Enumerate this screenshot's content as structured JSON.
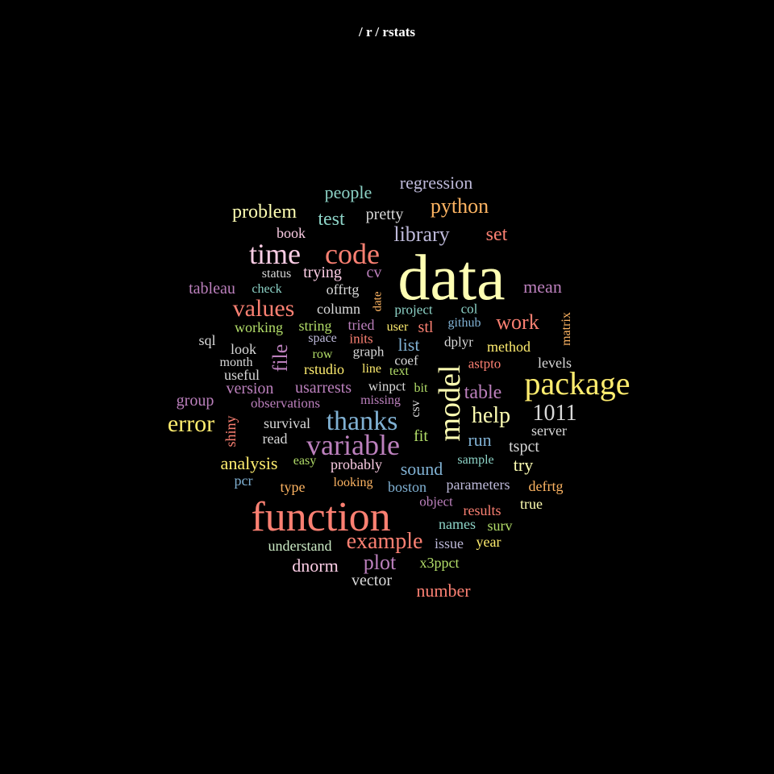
{
  "title": "/ r / rstats",
  "palette": {
    "yellow": "#FFFFB3",
    "red": "#FB8072",
    "blue": "#80B1D3",
    "orange": "#FDB462",
    "green": "#B3DE69",
    "pink": "#FCCDE5",
    "gray": "#D9D9D9",
    "purple": "#BC80BD",
    "mint": "#CCEBC5",
    "gold": "#FFED6F",
    "teal": "#8DD3C7",
    "lavender": "#BEBADA"
  },
  "words": [
    {
      "text": "data",
      "color": "#FFFFB3",
      "vertical": false
    },
    {
      "text": "function",
      "color": "#FB8072",
      "vertical": false
    },
    {
      "text": "package",
      "color": "#FFED6F",
      "vertical": false
    },
    {
      "text": "model",
      "color": "#FFFFB3",
      "vertical": true
    },
    {
      "text": "code",
      "color": "#FB8072",
      "vertical": false
    },
    {
      "text": "time",
      "color": "#FCCDE5",
      "vertical": false
    },
    {
      "text": "variable",
      "color": "#BC80BD",
      "vertical": false
    },
    {
      "text": "thanks",
      "color": "#80B1D3",
      "vertical": false
    },
    {
      "text": "values",
      "color": "#FB8072",
      "vertical": false
    },
    {
      "text": "error",
      "color": "#FFED6F",
      "vertical": false
    },
    {
      "text": "example",
      "color": "#FB8072",
      "vertical": false
    },
    {
      "text": "1011",
      "color": "#D9D9D9",
      "vertical": false
    },
    {
      "text": "help",
      "color": "#FFFFB3",
      "vertical": false
    },
    {
      "text": "python",
      "color": "#FDB462",
      "vertical": false
    },
    {
      "text": "library",
      "color": "#BEBADA",
      "vertical": false
    },
    {
      "text": "file",
      "color": "#BC80BD",
      "vertical": true
    },
    {
      "text": "plot",
      "color": "#BC80BD",
      "vertical": false
    },
    {
      "text": "problem",
      "color": "#FFFFB3",
      "vertical": false
    },
    {
      "text": "work",
      "color": "#FB8072",
      "vertical": false
    },
    {
      "text": "table",
      "color": "#BC80BD",
      "vertical": false
    },
    {
      "text": "regression",
      "color": "#BEBADA",
      "vertical": false
    },
    {
      "text": "test",
      "color": "#8DD3C7",
      "vertical": false
    },
    {
      "text": "list",
      "color": "#80B1D3",
      "vertical": false
    },
    {
      "text": "set",
      "color": "#FB8072",
      "vertical": false
    },
    {
      "text": "sound",
      "color": "#80B1D3",
      "vertical": false
    },
    {
      "text": "analysis",
      "color": "#FFED6F",
      "vertical": false
    },
    {
      "text": "mean",
      "color": "#BC80BD",
      "vertical": false
    },
    {
      "text": "people",
      "color": "#8DD3C7",
      "vertical": false
    },
    {
      "text": "pretty",
      "color": "#D9D9D9",
      "vertical": false
    },
    {
      "text": "number",
      "color": "#FB8072",
      "vertical": false
    },
    {
      "text": "run",
      "color": "#80B1D3",
      "vertical": false
    },
    {
      "text": "dnorm",
      "color": "#FCCDE5",
      "vertical": false
    },
    {
      "text": "usarrests",
      "color": "#BC80BD",
      "vertical": false
    },
    {
      "text": "try",
      "color": "#FFFFB3",
      "vertical": false
    },
    {
      "text": "vector",
      "color": "#D9D9D9",
      "vertical": false
    },
    {
      "text": "tableau",
      "color": "#BC80BD",
      "vertical": false
    },
    {
      "text": "cv",
      "color": "#BC80BD",
      "vertical": false
    },
    {
      "text": "trying",
      "color": "#FCCDE5",
      "vertical": false
    },
    {
      "text": "version",
      "color": "#BC80BD",
      "vertical": false
    },
    {
      "text": "probably",
      "color": "#FCCDE5",
      "vertical": false
    },
    {
      "text": "tspct",
      "color": "#D9D9D9",
      "vertical": false
    },
    {
      "text": "server",
      "color": "#D9D9D9",
      "vertical": false
    },
    {
      "text": "levels",
      "color": "#D9D9D9",
      "vertical": false
    },
    {
      "text": "book",
      "color": "#FCCDE5",
      "vertical": false
    },
    {
      "text": "read",
      "color": "#D9D9D9",
      "vertical": false
    },
    {
      "text": "year",
      "color": "#FFED6F",
      "vertical": false
    },
    {
      "text": "group",
      "color": "#BC80BD",
      "vertical": false
    },
    {
      "text": "method",
      "color": "#FFED6F",
      "vertical": false
    },
    {
      "text": "stl",
      "color": "#FB8072",
      "vertical": false
    },
    {
      "text": "fit",
      "color": "#B3DE69",
      "vertical": false
    },
    {
      "text": "look",
      "color": "#D9D9D9",
      "vertical": false
    },
    {
      "text": "working",
      "color": "#B3DE69",
      "vertical": false
    },
    {
      "text": "string",
      "color": "#B3DE69",
      "vertical": false
    },
    {
      "text": "tried",
      "color": "#BC80BD",
      "vertical": false
    },
    {
      "text": "boston",
      "color": "#80B1D3",
      "vertical": false
    },
    {
      "text": "parameters",
      "color": "#BEBADA",
      "vertical": false
    },
    {
      "text": "defrtg",
      "color": "#FDB462",
      "vertical": false
    },
    {
      "text": "results",
      "color": "#FB8072",
      "vertical": false
    },
    {
      "text": "true",
      "color": "#FFFFB3",
      "vertical": false
    },
    {
      "text": "names",
      "color": "#8DD3C7",
      "vertical": false
    },
    {
      "text": "surv",
      "color": "#B3DE69",
      "vertical": false
    },
    {
      "text": "understand",
      "color": "#CCEBC5",
      "vertical": false
    },
    {
      "text": "issue",
      "color": "#BEBADA",
      "vertical": false
    },
    {
      "text": "x3ppct",
      "color": "#B3DE69",
      "vertical": false
    },
    {
      "text": "type",
      "color": "#FDB462",
      "vertical": false
    },
    {
      "text": "looking",
      "color": "#FDB462",
      "vertical": false
    },
    {
      "text": "object",
      "color": "#BC80BD",
      "vertical": false
    },
    {
      "text": "pcr",
      "color": "#80B1D3",
      "vertical": false
    },
    {
      "text": "easy",
      "color": "#B3DE69",
      "vertical": false
    },
    {
      "text": "sample",
      "color": "#8DD3C7",
      "vertical": false
    },
    {
      "text": "survival",
      "color": "#D9D9D9",
      "vertical": false
    },
    {
      "text": "shiny",
      "color": "#FB8072",
      "vertical": true
    },
    {
      "text": "observations",
      "color": "#BC80BD",
      "vertical": false
    },
    {
      "text": "missing",
      "color": "#BC80BD",
      "vertical": false
    },
    {
      "text": "winpct",
      "color": "#D9D9D9",
      "vertical": false
    },
    {
      "text": "csv",
      "color": "#D9D9D9",
      "vertical": true
    },
    {
      "text": "bit",
      "color": "#B3DE69",
      "vertical": false
    },
    {
      "text": "useful",
      "color": "#D9D9D9",
      "vertical": false
    },
    {
      "text": "rstudio",
      "color": "#FFED6F",
      "vertical": false
    },
    {
      "text": "line",
      "color": "#FFED6F",
      "vertical": false
    },
    {
      "text": "text",
      "color": "#B3DE69",
      "vertical": false
    },
    {
      "text": "astpto",
      "color": "#FB8072",
      "vertical": false
    },
    {
      "text": "month",
      "color": "#D9D9D9",
      "vertical": false
    },
    {
      "text": "row",
      "color": "#B3DE69",
      "vertical": false
    },
    {
      "text": "graph",
      "color": "#D9D9D9",
      "vertical": false
    },
    {
      "text": "coef",
      "color": "#D9D9D9",
      "vertical": false
    },
    {
      "text": "dplyr",
      "color": "#D9D9D9",
      "vertical": false
    },
    {
      "text": "sql",
      "color": "#D9D9D9",
      "vertical": false
    },
    {
      "text": "space",
      "color": "#BEBADA",
      "vertical": false
    },
    {
      "text": "inits",
      "color": "#FB8072",
      "vertical": false
    },
    {
      "text": "user",
      "color": "#FFED6F",
      "vertical": false
    },
    {
      "text": "github",
      "color": "#80B1D3",
      "vertical": false
    },
    {
      "text": "matrix",
      "color": "#FDB462",
      "vertical": true
    },
    {
      "text": "column",
      "color": "#D9D9D9",
      "vertical": false
    },
    {
      "text": "project",
      "color": "#8DD3C7",
      "vertical": false
    },
    {
      "text": "col",
      "color": "#8DD3C7",
      "vertical": false
    },
    {
      "text": "date",
      "color": "#FDB462",
      "vertical": true
    },
    {
      "text": "check",
      "color": "#8DD3C7",
      "vertical": false
    },
    {
      "text": "status",
      "color": "#D9D9D9",
      "vertical": false
    },
    {
      "text": "offrtg",
      "color": "#D9D9D9",
      "vertical": false
    }
  ]
}
